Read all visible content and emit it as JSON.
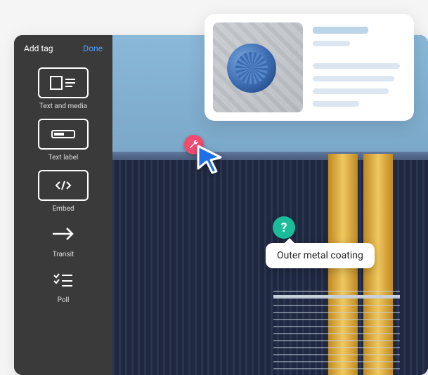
{
  "sidebar": {
    "title": "Add tag",
    "done_label": "Done",
    "items": [
      {
        "label": "Text and media",
        "icon": "text-media-icon"
      },
      {
        "label": "Text label",
        "icon": "text-label-icon"
      },
      {
        "label": "Embed",
        "icon": "embed-icon"
      },
      {
        "label": "Transit",
        "icon": "transit-icon"
      },
      {
        "label": "Poll",
        "icon": "poll-icon"
      }
    ]
  },
  "canvas": {
    "wrench_marker": "wrench-icon",
    "question_marker": "?",
    "tooltip_text": "Outer metal coating"
  },
  "card": {
    "thumbnail_alt": "industrial-motor"
  }
}
